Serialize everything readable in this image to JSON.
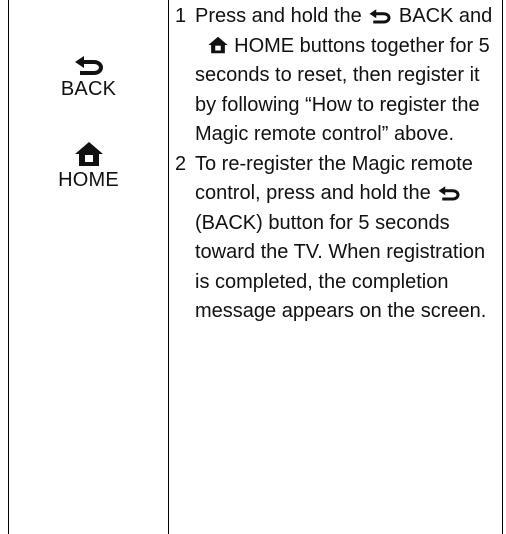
{
  "buttons": {
    "back": {
      "label": "BACK",
      "icon": "back-arrow-icon"
    },
    "home": {
      "label": "HOME",
      "icon": "home-icon"
    }
  },
  "steps": [
    {
      "number": "1",
      "text_pre": "Press and hold the",
      "text_mid": "BACK and",
      "text_post": "HOME buttons together for 5 seconds to reset, then register it by following “How to register the Magic remote control”  above."
    },
    {
      "number": "2",
      "text_pre": "To re-register the Magic remote control, press and hold the",
      "text_post": "(BACK) button for 5 seconds toward the TV. When registration is completed, the completion message appears on the screen."
    }
  ],
  "colors": {
    "text": "#111111",
    "border": "#000000"
  }
}
